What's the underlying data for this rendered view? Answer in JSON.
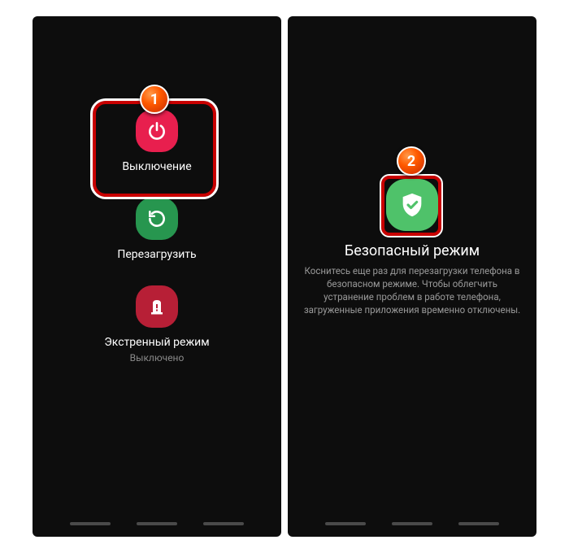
{
  "left": {
    "power": {
      "label": "Выключение"
    },
    "restart": {
      "label": "Перезагрузить"
    },
    "emergency": {
      "label": "Экстренный режим",
      "sublabel": "Выключено"
    }
  },
  "right": {
    "title": "Безопасный режим",
    "description": "Коснитесь еще раз для перезагрузки телефона в безопасном режиме. Чтобы облегчить устранение проблем в работе телефона, загруженные приложения временно отключены."
  },
  "badges": {
    "b1": "1",
    "b2": "2"
  }
}
